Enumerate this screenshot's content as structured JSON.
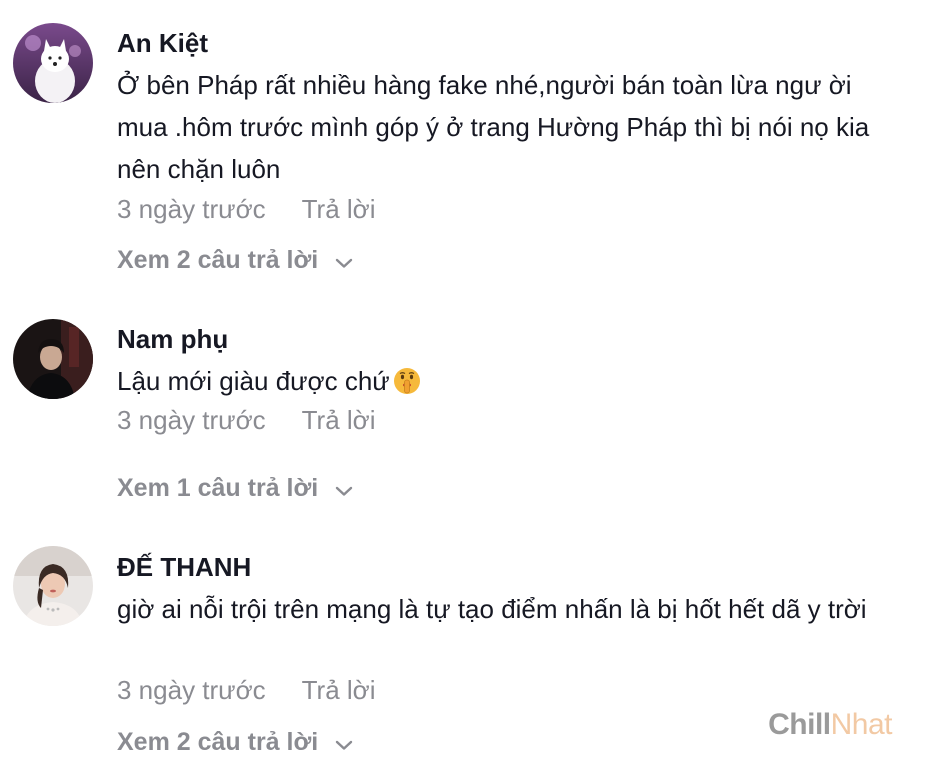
{
  "comments": [
    {
      "username": "An Kiệt",
      "text": "Ở bên Pháp rất nhiều hàng fake nhé,người bán toàn lừa ngư ời mua .hôm trước mình góp ý ở trang Hường Pháp thì bị nói nọ kia nên chặn luôn",
      "time": "3 ngày trước",
      "reply_label": "Trả lời",
      "view_replies": "Xem 2 câu trả lời"
    },
    {
      "username": "Nam phụ",
      "text": "Lậu mới giàu được chứ",
      "emoji": "shushing-face-icon",
      "time": "3 ngày trước",
      "reply_label": "Trả lời",
      "view_replies": "Xem 1 câu trả lời"
    },
    {
      "username": "ĐẾ THANH",
      "text": "giờ ai nỗi trội trên mạng là tự tạo điểm nhấn là bị hốt hết dã y trời",
      "time": "3 ngày trước",
      "reply_label": "Trả lời",
      "view_replies": "Xem 2 câu trả lời"
    }
  ],
  "watermark": {
    "part1": "Chill",
    "part2": "Nhat"
  },
  "colors": {
    "text": "#161823",
    "muted": "#8a8b91"
  }
}
